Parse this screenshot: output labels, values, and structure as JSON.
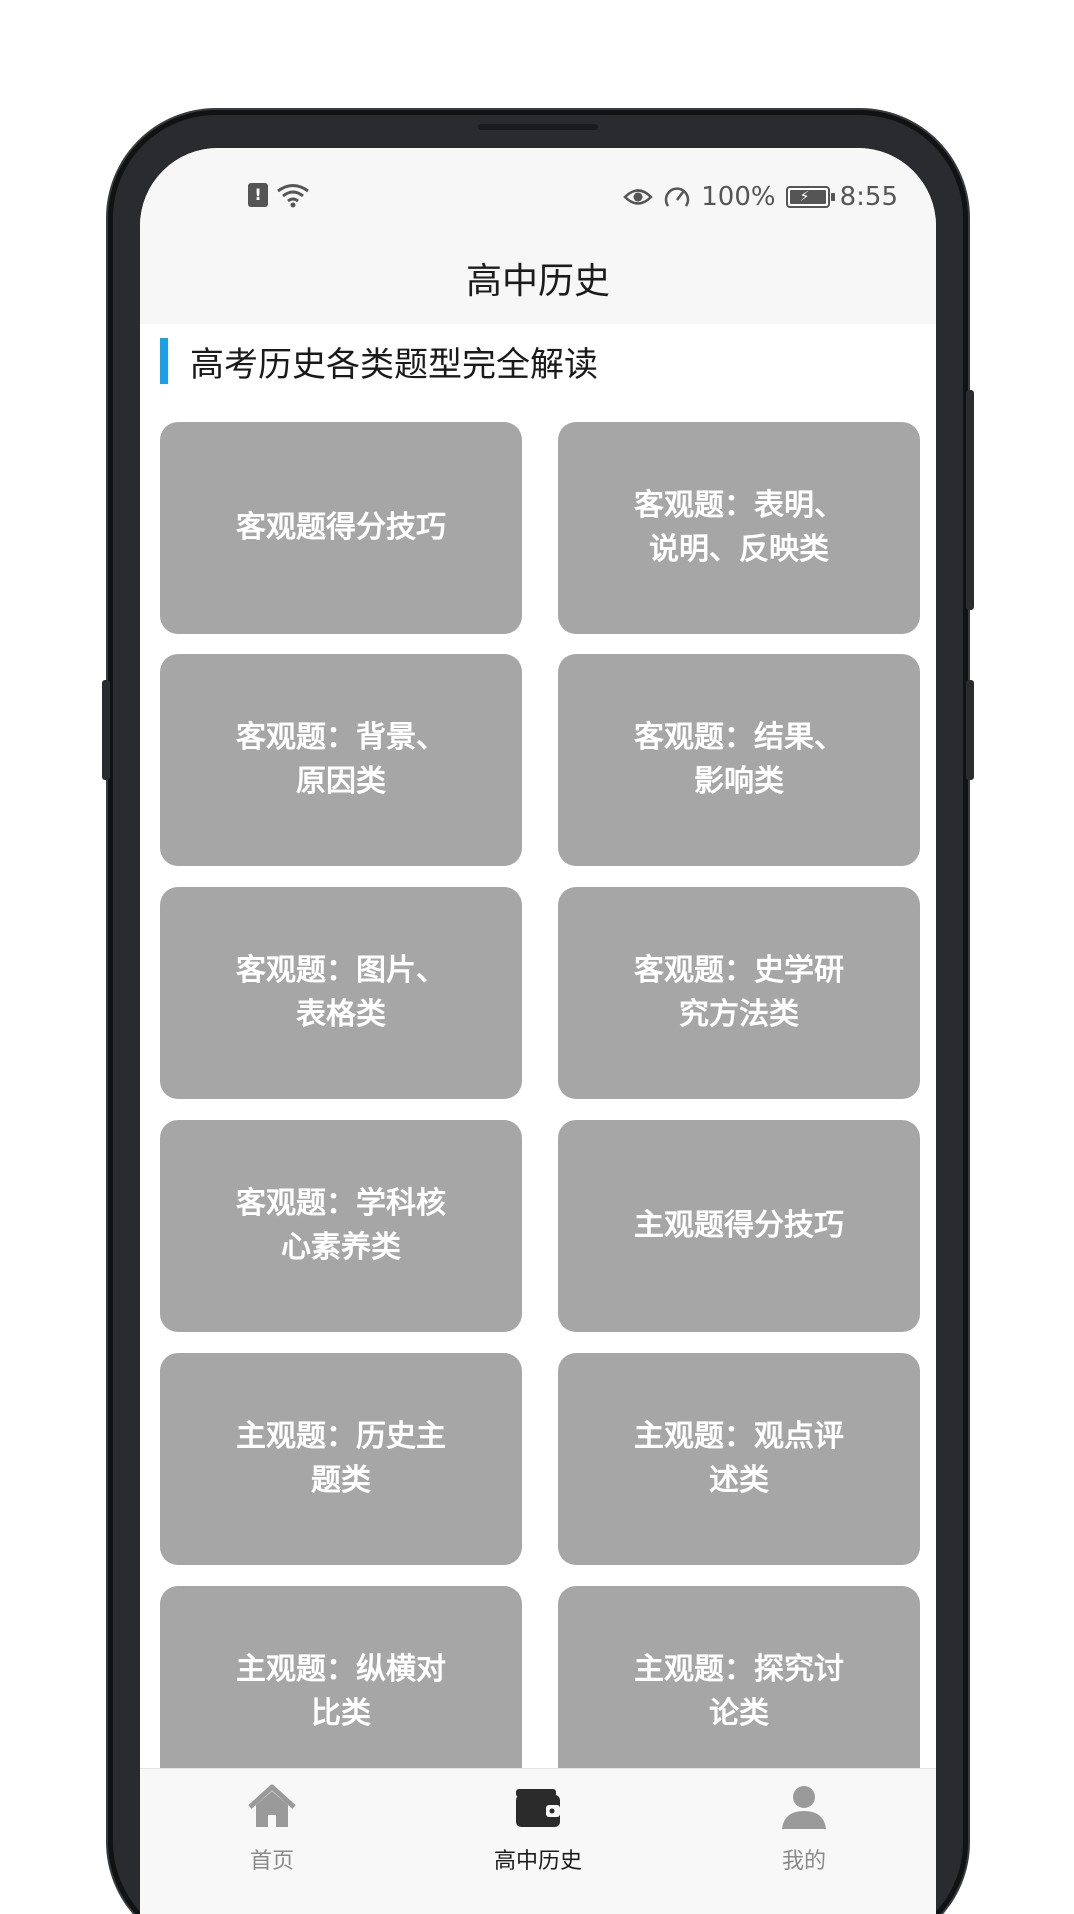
{
  "status_bar": {
    "battery_percent": "100%",
    "time": "8:55",
    "sim_glyph": "!"
  },
  "header": {
    "title": "高中历史"
  },
  "section": {
    "heading": "高考历史各类题型完全解读"
  },
  "cards": [
    {
      "line1": "客观题得分技巧",
      "line2": ""
    },
    {
      "line1": "客观题：表明、",
      "line2": "说明、反映类"
    },
    {
      "line1": "客观题：背景、",
      "line2": "原因类"
    },
    {
      "line1": "客观题：结果、",
      "line2": "影响类"
    },
    {
      "line1": "客观题：图片、",
      "line2": "表格类"
    },
    {
      "line1": "客观题：史学研",
      "line2": "究方法类"
    },
    {
      "line1": "客观题：学科核",
      "line2": "心素养类"
    },
    {
      "line1": "主观题得分技巧",
      "line2": ""
    },
    {
      "line1": "主观题：历史主",
      "line2": "题类"
    },
    {
      "line1": "主观题：观点评",
      "line2": "述类"
    },
    {
      "line1": "主观题：纵横对",
      "line2": "比类"
    },
    {
      "line1": "主观题：探究讨",
      "line2": "论类"
    }
  ],
  "tabbar": {
    "home": {
      "label": "首页",
      "icon": "home-icon"
    },
    "history": {
      "label": "高中历史",
      "icon": "wallet-icon"
    },
    "me": {
      "label": "我的",
      "icon": "user-icon"
    }
  },
  "colors": {
    "accent": "#1aa0e6",
    "card_bg": "#a6a6a6",
    "card_text": "#ffffff"
  }
}
